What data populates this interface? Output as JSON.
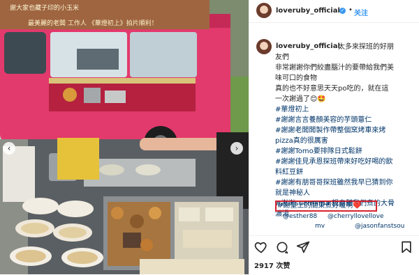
{
  "post": {
    "username": "loveruby_official",
    "follow_label": "关注",
    "caption_lines": [
      {
        "text": "太多來探班的好朋",
        "tag": false
      },
      {
        "text": "友們",
        "tag": false
      },
      {
        "text": "非常謝謝你們絞盡腦汁的要帶給我們美",
        "tag": false
      },
      {
        "text": "味可口的食物",
        "tag": false
      },
      {
        "text": "真的也不好意思天天po吃的，就在這",
        "tag": false
      },
      {
        "text": "一次謝過了😊🤩",
        "tag": false
      },
      {
        "text": "#華燈初上",
        "tag": true
      },
      {
        "text": "#謝謝言言養顏美容的芋頭薏仁",
        "tag": true
      },
      {
        "text": "#謝謝老闆闆製作帶整個窯烤車來烤",
        "tag": true
      },
      {
        "text": "pizza真的很厲害",
        "tag": true
      },
      {
        "text": "#謝謝Tomo要排隊日式鬆餅",
        "tag": true
      },
      {
        "text": "#謝謝佳見承恩探班帶來好吃好喝的飲",
        "tag": true
      },
      {
        "text": "料紅豆餅",
        "tag": true
      },
      {
        "text": "#謝謝有朋哥哥探班雖然我早已猜到你",
        "tag": true
      },
      {
        "text": "就是神秘人",
        "tag": true
      },
      {
        "text": "#謝謝suemama 親自幫我們煮的大骨",
        "tag": true
      },
      {
        "text": "濃湯",
        "tag": true
      }
    ],
    "highlight_text": "#謝皇上的關東煮好暖啊❤️",
    "mentions": [
      "@esther88",
      "@cherryllovellove",
      "mv",
      "@jasonfanstsou"
    ],
    "views": "2917 次赞",
    "truck_sign_top": "謝大家也藏子印的小玉米",
    "truck_sign_bottom": "最美麗的老闆  工作人 《華燈初上》拍片順利！",
    "colors": {
      "accent": "#3897f0",
      "highlight_border": "#d4232f",
      "truck": "#e23a6c"
    },
    "icons": [
      "verified-badge-icon",
      "heart-icon",
      "comment-icon",
      "share-icon",
      "bookmark-icon",
      "chevron-left-icon",
      "chevron-right-icon"
    ]
  }
}
